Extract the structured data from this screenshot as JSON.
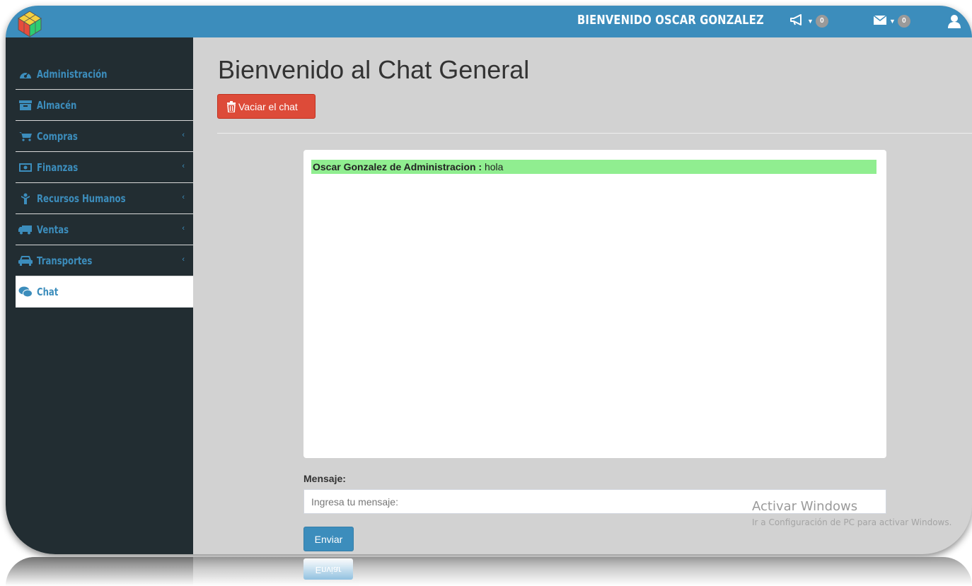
{
  "topbar": {
    "welcome": "Bienvenido Oscar Gonzalez",
    "notifications_count": "0",
    "messages_count": "0"
  },
  "sidebar": {
    "items": [
      {
        "label": "Administración",
        "icon": "dashboard-icon",
        "has_submenu": false
      },
      {
        "label": "Almacén",
        "icon": "archive-icon",
        "has_submenu": false
      },
      {
        "label": "Compras",
        "icon": "cart-icon",
        "has_submenu": true
      },
      {
        "label": "Finanzas",
        "icon": "money-icon",
        "has_submenu": true
      },
      {
        "label": "Recursos Humanos",
        "icon": "person-icon",
        "has_submenu": true
      },
      {
        "label": "Ventas",
        "icon": "truck-icon",
        "has_submenu": true
      },
      {
        "label": "Transportes",
        "icon": "car-icon",
        "has_submenu": true
      },
      {
        "label": "Chat",
        "icon": "chat-icon",
        "has_submenu": false,
        "active": true
      }
    ],
    "chevron": "‹"
  },
  "main": {
    "title": "Bienvenido al Chat General",
    "clear_button": "Vaciar el chat",
    "messages": [
      {
        "author": "Oscar Gonzalez de Administracion :",
        "text": " hola"
      }
    ],
    "message_label": "Mensaje:",
    "message_placeholder": "Ingresa tu mensaje:",
    "send_button": "Enviar"
  },
  "watermark": {
    "line1": "Activar Windows",
    "line2": "Ir a Configuración de PC para activar Windows."
  },
  "reflection": {
    "send_button_mirror": "Enviar"
  },
  "colors": {
    "header": "#3c8dbc",
    "sidebar": "#222d32",
    "content_bg": "#d2d2d2",
    "danger": "#dd4b39",
    "primary": "#3c8dbc",
    "message_highlight": "#90ee90"
  }
}
